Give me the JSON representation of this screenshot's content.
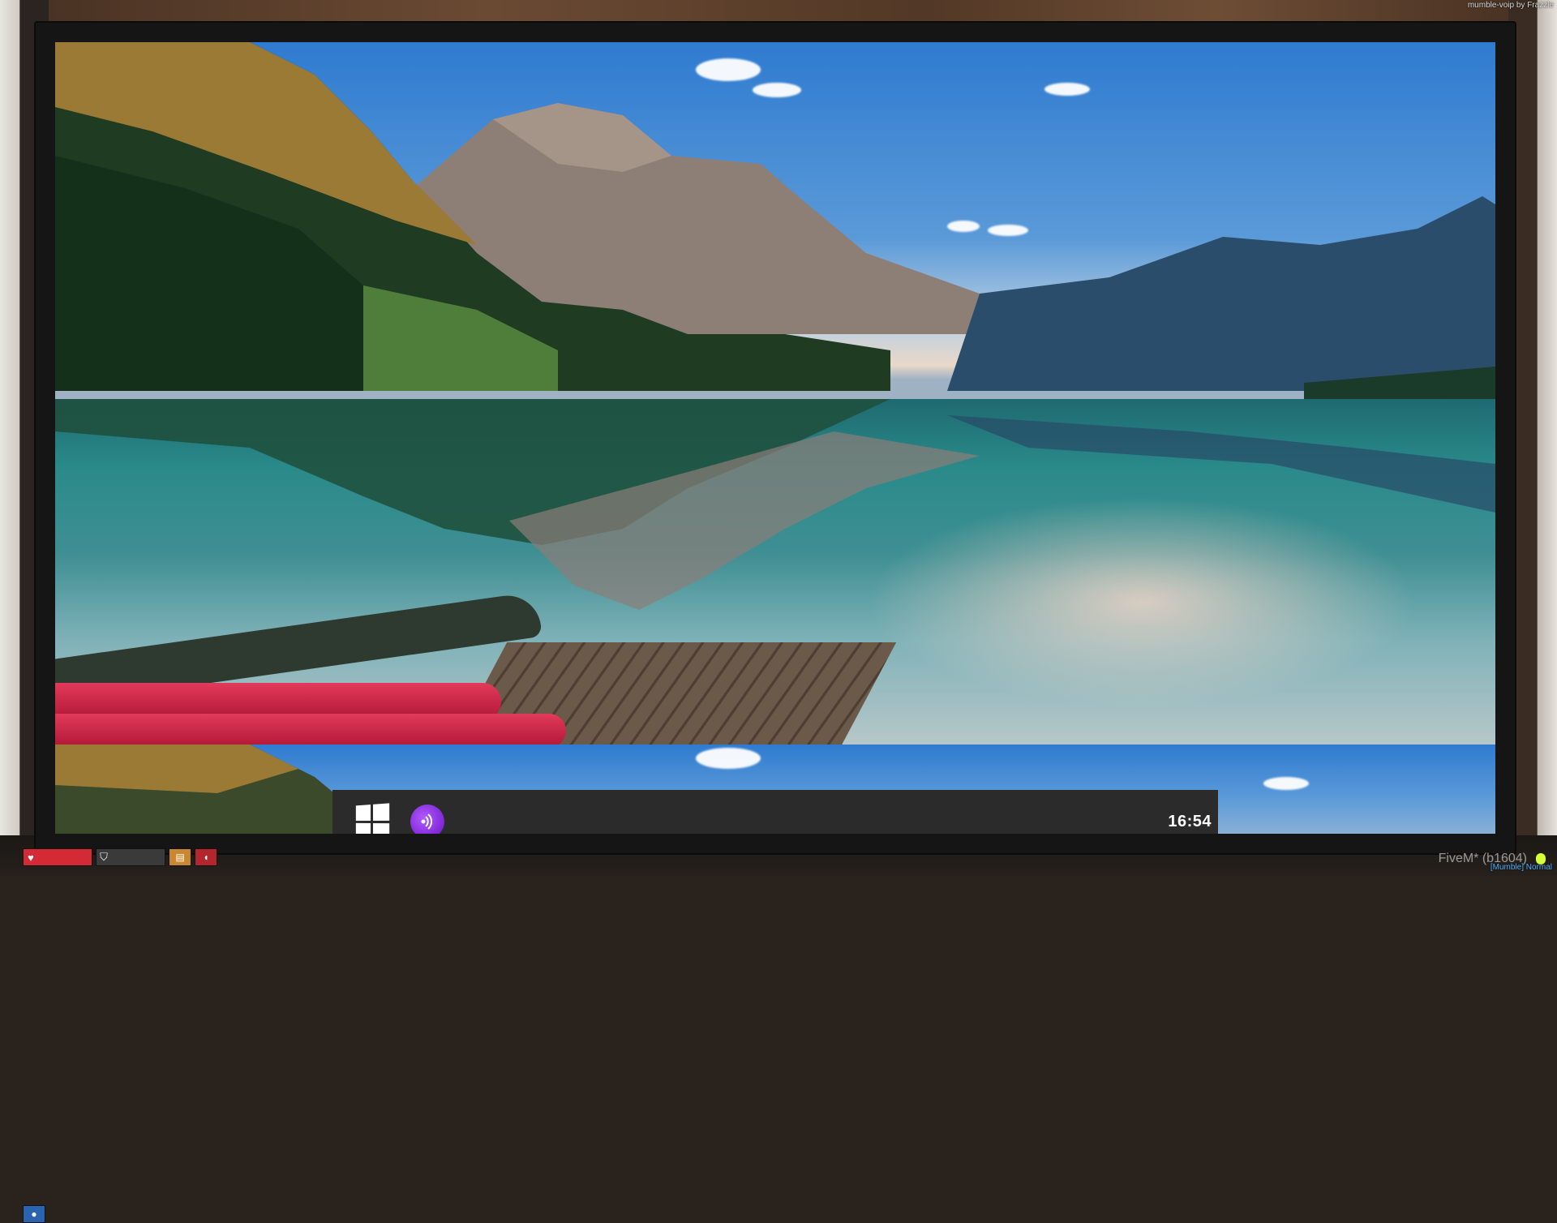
{
  "overlay": {
    "credit_text": "mumble-voip by Frazzle",
    "build_text": "FiveM* (b1604)",
    "mumble_status": "[Mumble] Normal"
  },
  "desktop": {
    "wallpaper": "mountain-lake-landscape"
  },
  "taskbar": {
    "start_icon": "windows-logo-icon",
    "app_icon": "purple-audio-app-icon",
    "clock": "16:54"
  },
  "hud": {
    "health_icon": "heart-icon",
    "armor_icon": "shield-icon",
    "status_icons": [
      "food-icon",
      "water-icon",
      "stress-icon"
    ]
  },
  "colors": {
    "taskbar_bg": "#2b2b2b",
    "health": "#d42a36",
    "app_icon": "#8a2be2",
    "mumble": "#4db0ff"
  }
}
